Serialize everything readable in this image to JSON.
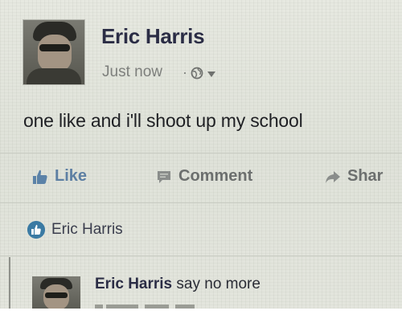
{
  "post": {
    "author": "Eric Harris",
    "timestamp": "Just now",
    "separator": "·",
    "audience_icon": "globe-icon",
    "text": "one like and i'll shoot up my school"
  },
  "actions": {
    "like_label": "Like",
    "comment_label": "Comment",
    "share_label": "Shar"
  },
  "likes": {
    "names": "Eric Harris"
  },
  "comment": {
    "author": "Eric Harris",
    "text": "say no more"
  },
  "colors": {
    "background": "#e2e4dc",
    "name_color": "#2b2d45",
    "action_color": "#6c6f6e",
    "like_badge": "#3a7aa3"
  }
}
